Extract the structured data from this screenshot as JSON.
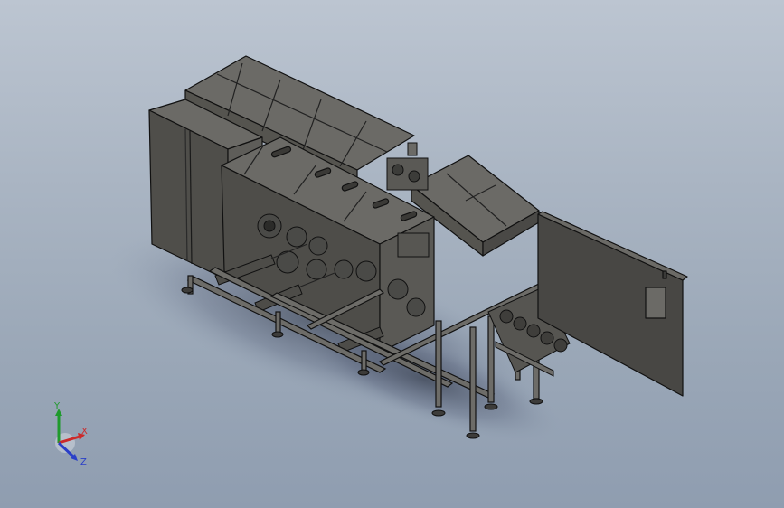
{
  "viewport": {
    "background_top": "#bcc5d1",
    "background_bottom": "#8f9db0"
  },
  "model": {
    "icon": "cad-assembly-icon",
    "colors": {
      "top": "#6b6a66",
      "side_light": "#5e5d59",
      "side_dark": "#4a4946",
      "edge": "#111111",
      "frame": "#6d6c68"
    }
  },
  "triad": {
    "x_label": "X",
    "y_label": "Y",
    "z_label": "Z",
    "x_color": "#cc2a2a",
    "y_color": "#1f9a2c",
    "z_color": "#2a3fc8"
  }
}
